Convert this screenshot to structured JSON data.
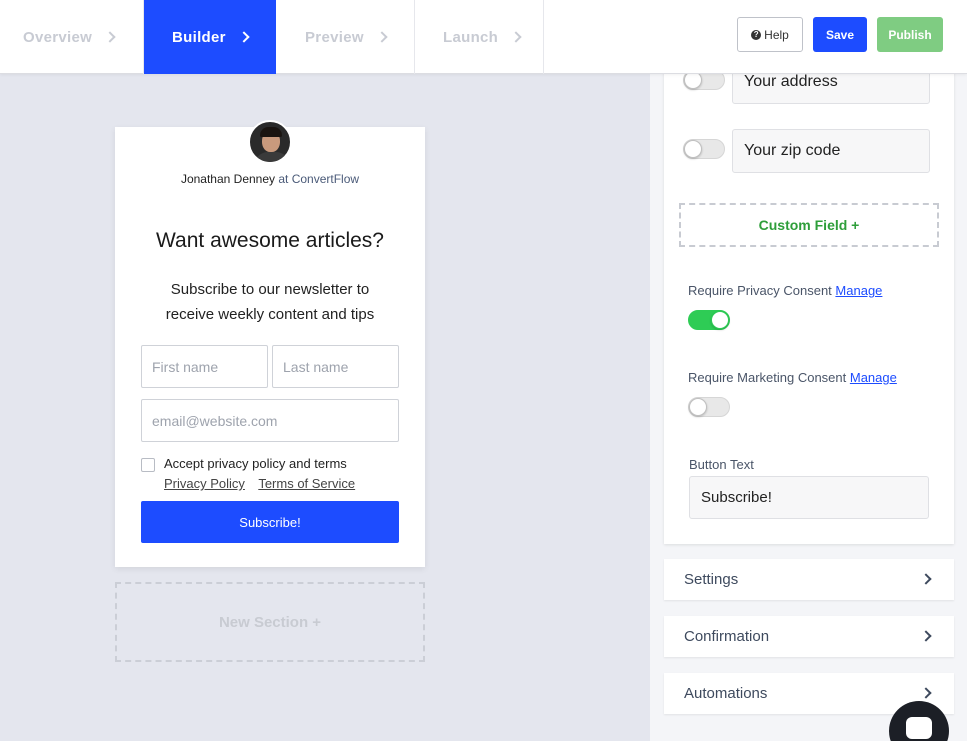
{
  "steps": [
    {
      "label": "Overview"
    },
    {
      "label": "Builder"
    },
    {
      "label": "Preview"
    },
    {
      "label": "Launch"
    }
  ],
  "toolbar": {
    "help_label": "Help",
    "save_label": "Save",
    "publish_label": "Publish"
  },
  "form": {
    "author_name": "Jonathan Denney",
    "author_at": "at ConvertFlow",
    "headline": "Want awesome articles?",
    "subtext": "Subscribe to our newsletter to receive weekly content and tips",
    "first_name_placeholder": "First name",
    "last_name_placeholder": "Last name",
    "email_placeholder": "email@website.com",
    "consent_label": "Accept privacy policy and terms",
    "privacy_link": "Privacy Policy",
    "terms_link": "Terms of Service",
    "submit_label": "Subscribe!"
  },
  "canvas": {
    "new_section_label": "New Section +"
  },
  "panel": {
    "fields": [
      {
        "label": "Your address",
        "enabled": false
      },
      {
        "label": "Your zip code",
        "enabled": false
      }
    ],
    "custom_field_label": "Custom Field +",
    "privacy_consent_label": "Require Privacy Consent",
    "privacy_consent_enabled": true,
    "marketing_consent_label": "Require Marketing Consent",
    "marketing_consent_enabled": false,
    "manage_label": "Manage",
    "button_text_label": "Button Text",
    "button_text_value": "Subscribe!",
    "sections": [
      {
        "label": "Settings"
      },
      {
        "label": "Confirmation"
      },
      {
        "label": "Automations"
      }
    ]
  },
  "colors": {
    "brand": "#1d4cff",
    "publish": "#7fcc82",
    "toggle_on": "#2ecc55",
    "custom_field": "#2e9e3a"
  }
}
